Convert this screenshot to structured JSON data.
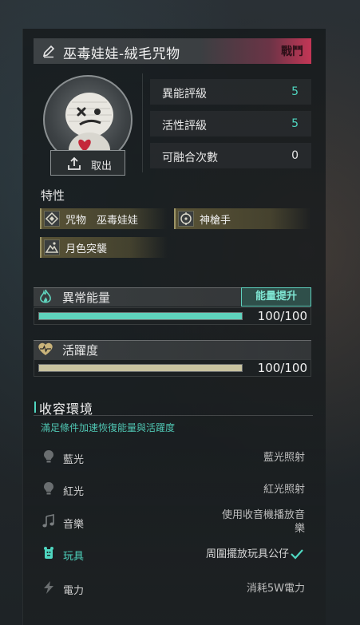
{
  "header": {
    "name": "巫毒娃娃-絨毛咒物",
    "tag": "戰鬥"
  },
  "avatar": {
    "takeout_label": "取出"
  },
  "stats": [
    {
      "label": "異能評級",
      "value": "5",
      "accent": true
    },
    {
      "label": "活性評級",
      "value": "5",
      "accent": true
    },
    {
      "label": "可融合次數",
      "value": "0",
      "accent": false
    }
  ],
  "traits": {
    "title": "特性",
    "items": [
      {
        "label": "咒物　巫毒娃娃",
        "icon": "diamond-icon"
      },
      {
        "label": "神槍手",
        "icon": "crosshair-icon"
      },
      {
        "label": "月色突襲",
        "icon": "mountain-icon"
      }
    ]
  },
  "bars": {
    "energy": {
      "title": "異常能量",
      "button": "能量提升",
      "value_text": "100/100",
      "fill_fraction": 1.0,
      "color": "#5fd3bd"
    },
    "activity": {
      "title": "活躍度",
      "value_text": "100/100",
      "fill_fraction": 1.0,
      "color": "#c9c3a0"
    }
  },
  "environment": {
    "title": "收容環境",
    "subtitle": "滿足條件加速恢復能量與活躍度",
    "items": [
      {
        "name": "藍光",
        "desc": "藍光照射",
        "icon": "lightbulb-icon",
        "active": false
      },
      {
        "name": "紅光",
        "desc": "紅光照射",
        "icon": "lightbulb-icon",
        "active": false
      },
      {
        "name": "音樂",
        "desc": "使用收音機播放音樂",
        "desc_line1": "使用收音機播放音",
        "desc_line2": "樂",
        "icon": "music-note-icon",
        "active": false
      },
      {
        "name": "玩具",
        "desc": "周圍擺放玩具公仔",
        "icon": "toy-icon",
        "active": true
      },
      {
        "name": "電力",
        "desc": "消耗5W電力",
        "icon": "lightning-icon",
        "active": false
      }
    ]
  },
  "colors": {
    "accent": "#4fd6c0",
    "header_highlight": "#c43656"
  }
}
